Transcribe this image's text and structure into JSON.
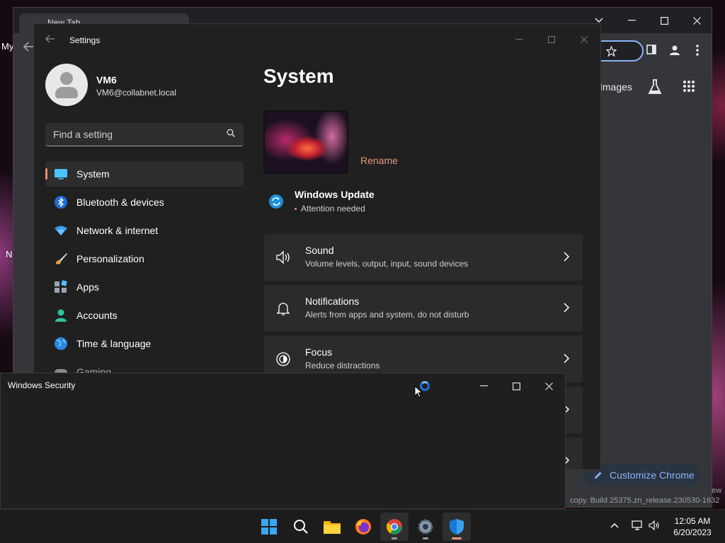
{
  "desktop": {
    "frag_my": "My",
    "frag_n": "N"
  },
  "chrome": {
    "tab_title": "New Tab",
    "images_link": "Images",
    "customize_label": "Customize Chrome",
    "build_text": "copy. Build 25375.zn_release.230530-1632",
    "ew_text": "ew"
  },
  "settings": {
    "window_title": "Settings",
    "user": {
      "name": "VM6",
      "email": "VM6@collabnet.local"
    },
    "search_placeholder": "Find a setting",
    "nav": [
      {
        "label": "System",
        "icon": "system-icon",
        "active": true
      },
      {
        "label": "Bluetooth & devices",
        "icon": "bluetooth-icon"
      },
      {
        "label": "Network & internet",
        "icon": "wifi-icon"
      },
      {
        "label": "Personalization",
        "icon": "brush-icon"
      },
      {
        "label": "Apps",
        "icon": "apps-icon"
      },
      {
        "label": "Accounts",
        "icon": "person-icon"
      },
      {
        "label": "Time & language",
        "icon": "globe-icon"
      },
      {
        "label": "Gaming",
        "icon": "gamepad-icon"
      }
    ],
    "page_title": "System",
    "rename_label": "Rename",
    "windows_update": {
      "title": "Windows Update",
      "status": "Attention needed"
    },
    "cards": [
      {
        "title": "Sound",
        "subtitle": "Volume levels, output, input, sound devices",
        "icon": "speaker-icon"
      },
      {
        "title": "Notifications",
        "subtitle": "Alerts from apps and system, do not disturb",
        "icon": "bell-icon"
      },
      {
        "title": "Focus",
        "subtitle": "Reduce distractions",
        "icon": "focus-icon"
      }
    ]
  },
  "winsec": {
    "title": "Windows Security"
  },
  "taskbar": {
    "apps": [
      "start-icon",
      "search-icon",
      "file-explorer-icon",
      "firefox-icon",
      "chrome-icon",
      "settings-icon",
      "windows-security-icon"
    ],
    "time": "12:05 AM",
    "date": "6/20/2023"
  },
  "colors": {
    "accent": "#e8957c",
    "chrome_blue": "#8ab4f8",
    "settings_bg": "#202020",
    "card_bg": "#2b2b2b"
  }
}
